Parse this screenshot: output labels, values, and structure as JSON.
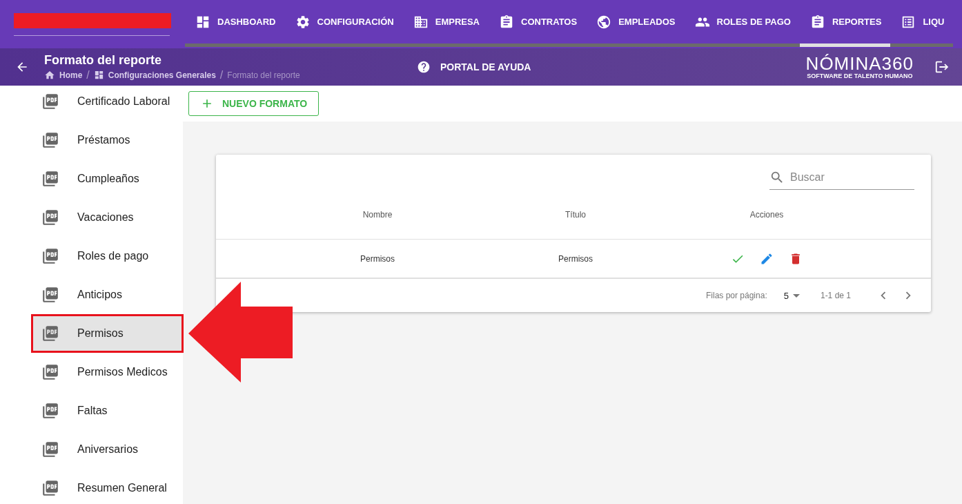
{
  "nav": {
    "tabs": [
      {
        "label": "DASHBOARD",
        "selected": false
      },
      {
        "label": "CONFIGURACIÓN",
        "selected": false
      },
      {
        "label": "EMPRESA",
        "selected": false
      },
      {
        "label": "CONTRATOS",
        "selected": false
      },
      {
        "label": "EMPLEADOS",
        "selected": false
      },
      {
        "label": "ROLES DE PAGO",
        "selected": false
      },
      {
        "label": "REPORTES",
        "selected": true
      },
      {
        "label": "LIQU",
        "selected": false
      }
    ]
  },
  "header": {
    "title": "Formato del reporte",
    "breadcrumb": [
      "Home",
      "Configuraciones Generales",
      "Formato del reporte"
    ],
    "separator": "/",
    "help": "PORTAL DE AYUDA",
    "logo": {
      "name": "NÓMINA360",
      "tagline": "SOFTWARE DE TALENTO HUMANO"
    }
  },
  "sidebar": {
    "items": [
      {
        "label": "Certificado Laboral",
        "selected": false
      },
      {
        "label": "Préstamos",
        "selected": false
      },
      {
        "label": "Cumpleaños",
        "selected": false
      },
      {
        "label": "Vacaciones",
        "selected": false
      },
      {
        "label": "Roles de pago",
        "selected": false
      },
      {
        "label": "Anticipos",
        "selected": false
      },
      {
        "label": "Permisos",
        "selected": true
      },
      {
        "label": "Permisos Medicos",
        "selected": false
      },
      {
        "label": "Faltas",
        "selected": false
      },
      {
        "label": "Aniversarios",
        "selected": false
      },
      {
        "label": "Resumen General",
        "selected": false
      }
    ]
  },
  "new_button": "NUEVO FORMATO",
  "table": {
    "search": {
      "placeholder": "Buscar"
    },
    "columns": [
      "Nombre",
      "Título",
      "Acciones"
    ],
    "rows": [
      {
        "nombre": "Permisos",
        "titulo": "Permisos"
      }
    ],
    "pagination": {
      "rows_label": "Filas por página:",
      "rows_per_page": "5",
      "range": "1-1 de 1"
    }
  }
}
